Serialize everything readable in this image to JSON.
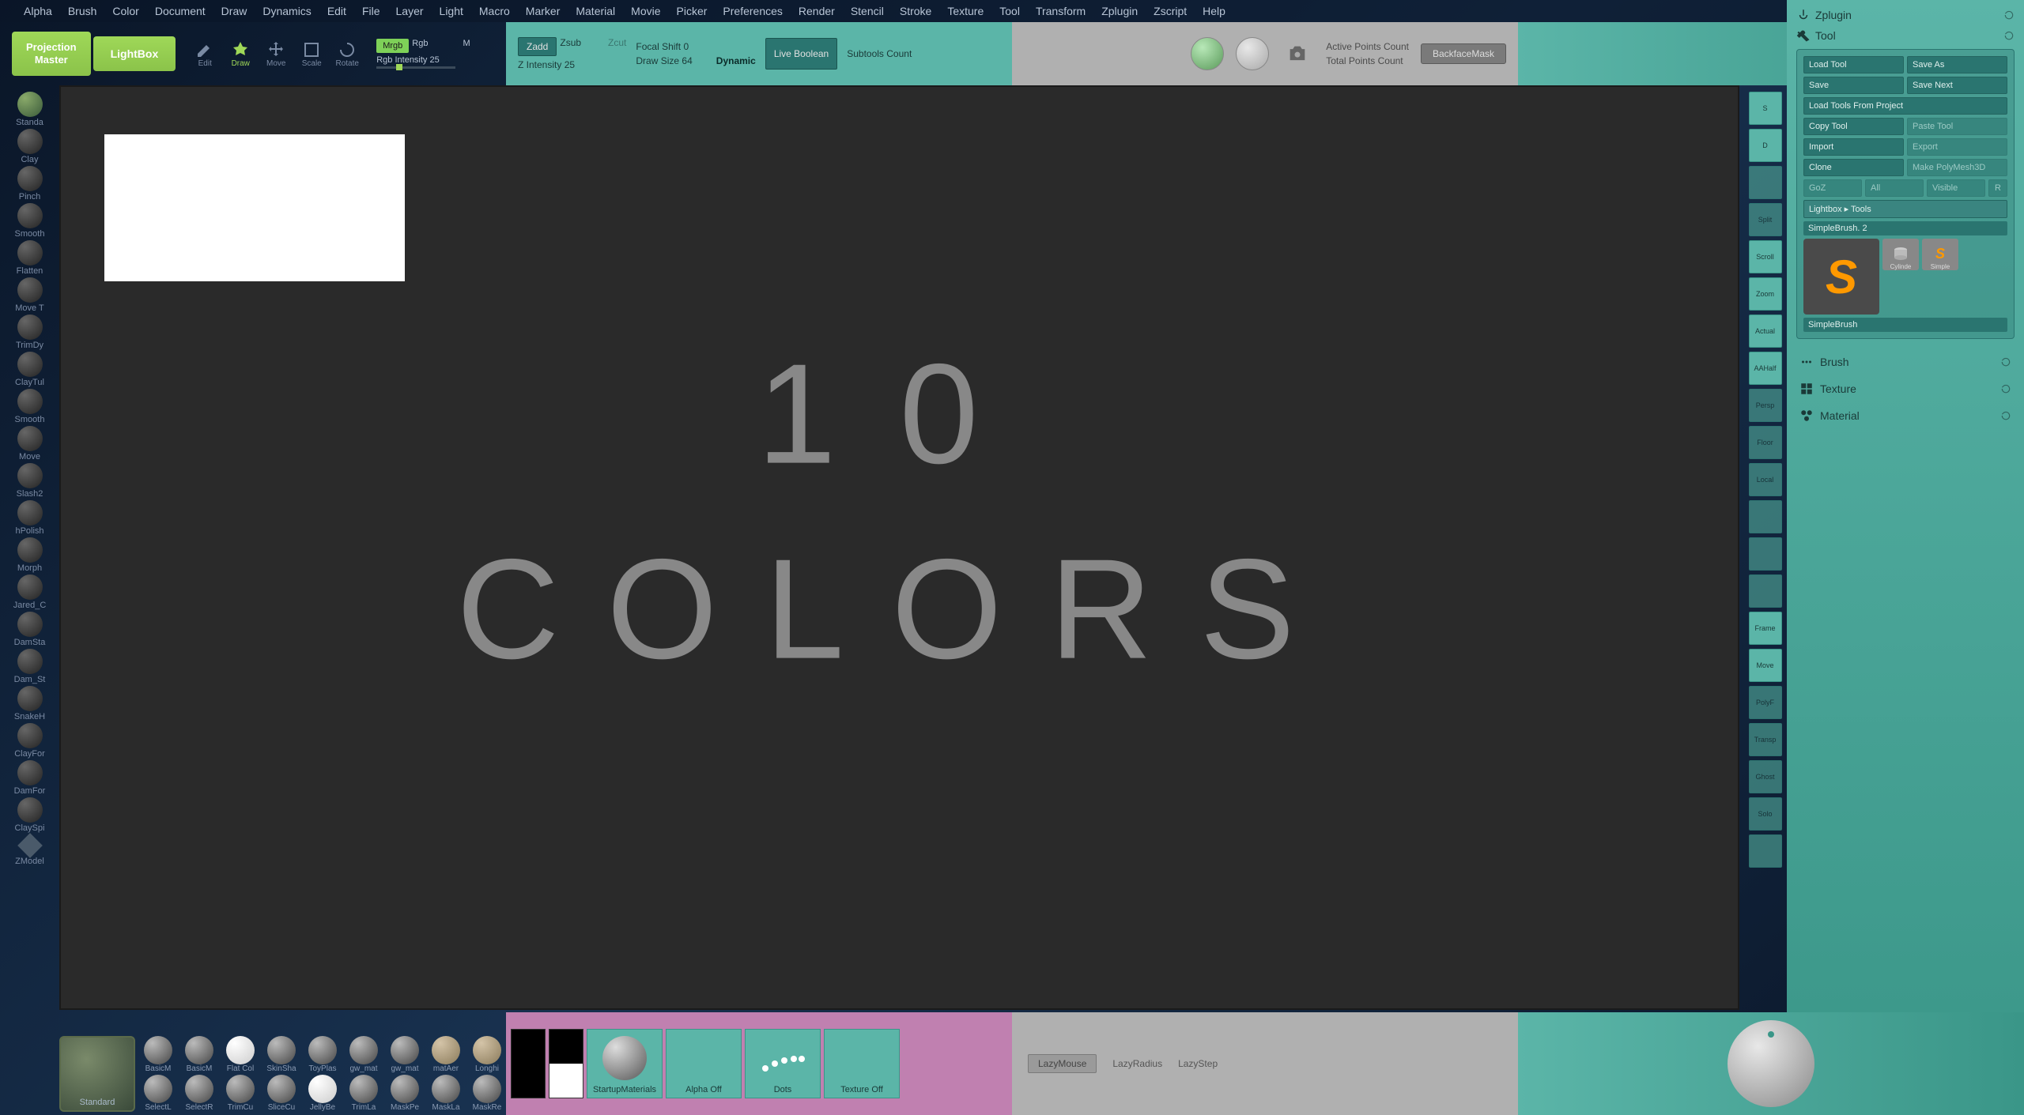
{
  "menu": [
    "Alpha",
    "Brush",
    "Color",
    "Document",
    "Draw",
    "Dynamics",
    "Edit",
    "File",
    "Layer",
    "Light",
    "Macro",
    "Marker",
    "Material",
    "Movie",
    "Picker",
    "Preferences",
    "Render",
    "Stencil",
    "Stroke",
    "Texture",
    "Tool",
    "Transform",
    "Zplugin",
    "Zscript",
    "Help"
  ],
  "toolbar": {
    "projection_master": "Projection\nMaster",
    "lightbox": "LightBox",
    "edit": "Edit",
    "draw": "Draw",
    "move": "Move",
    "scale": "Scale",
    "rotate": "Rotate",
    "mrgb": "Mrgb",
    "rgb": "Rgb",
    "m": "M",
    "rgb_intensity_label": "Rgb Intensity",
    "rgb_intensity_val": "25",
    "zadd": "Zadd",
    "zsub": "Zsub",
    "zcut": "Zcut",
    "z_intensity_label": "Z Intensity",
    "z_intensity_val": "25",
    "focal_shift_label": "Focal Shift",
    "focal_shift_val": "0",
    "draw_size_label": "Draw Size",
    "draw_size_val": "64",
    "dynamic": "Dynamic",
    "live_boolean": "Live Boolean",
    "subtools_count": "Subtools Count",
    "active_points": "Active Points Count",
    "total_points": "Total Points Count",
    "backface_mask": "BackfaceMask"
  },
  "left_brushes": [
    "Standa",
    "Clay",
    "Pinch",
    "Smooth",
    "Flatten",
    "Move T",
    "TrimDy",
    "ClayTul",
    "Smooth",
    "Move",
    "Slash2",
    "hPolish",
    "Morph",
    "Jared_C",
    "DamSta",
    "Dam_St",
    "SnakeH",
    "ClayFor",
    "DamFor",
    "ClaySpi",
    "ZModel"
  ],
  "canvas": {
    "line1": "10",
    "line2": "COLORS"
  },
  "right_rail": [
    {
      "label": "S",
      "name": "sculptris-pro"
    },
    {
      "label": "D",
      "name": "dynamesh"
    },
    {
      "label": "",
      "name": "rail-item-1",
      "dim": true
    },
    {
      "label": "Split",
      "name": "split",
      "dim": true
    },
    {
      "label": "Scroll",
      "name": "scroll"
    },
    {
      "label": "Zoom",
      "name": "zoom"
    },
    {
      "label": "Actual",
      "name": "actual"
    },
    {
      "label": "AAHalf",
      "name": "aahalf"
    },
    {
      "label": "Persp",
      "name": "persp",
      "dim": true
    },
    {
      "label": "Floor",
      "name": "floor",
      "dim": true
    },
    {
      "label": "Local",
      "name": "local",
      "dim": true
    },
    {
      "label": "",
      "name": "rail-item-2",
      "dim": true
    },
    {
      "label": "",
      "name": "rail-item-3",
      "dim": true
    },
    {
      "label": "",
      "name": "rail-item-4",
      "dim": true
    },
    {
      "label": "Frame",
      "name": "frame"
    },
    {
      "label": "Move",
      "name": "move-view"
    },
    {
      "label": "PolyF",
      "name": "polyf",
      "dim": true
    },
    {
      "label": "Transp",
      "name": "transp",
      "dim": true
    },
    {
      "label": "Ghost",
      "name": "ghost",
      "dim": true
    },
    {
      "label": "Solo",
      "name": "solo",
      "dim": true
    },
    {
      "label": "",
      "name": "rail-item-5",
      "dim": true
    }
  ],
  "right_panel": {
    "zplugin": "Zplugin",
    "tool": "Tool",
    "load_tool": "Load Tool",
    "save_as": "Save As",
    "save": "Save",
    "save_next": "Save Next",
    "load_from_project": "Load Tools From Project",
    "copy_tool": "Copy Tool",
    "paste_tool": "Paste Tool",
    "import": "Import",
    "export": "Export",
    "clone": "Clone",
    "make_polymesh": "Make PolyMesh3D",
    "goz": "GoZ",
    "all": "All",
    "visible": "Visible",
    "r": "R",
    "lightbox_tools": "Lightbox ▸ Tools",
    "simplebrush_row": "SimpleBrush. 2",
    "cylinder": "Cylinde",
    "simple": "Simple",
    "simplebrush_label": "SimpleBrush",
    "brush": "Brush",
    "texture": "Texture",
    "material": "Material"
  },
  "bottom": {
    "active_brush": "Standard",
    "materials1": [
      "BasicM",
      "BasicM",
      "Flat Col",
      "SkinSha",
      "ToyPlas",
      "gw_mat",
      "gw_mat",
      "matAer",
      "Longhi"
    ],
    "materials2": [
      "SelectL",
      "SelectR",
      "TrimCu",
      "SliceCu",
      "JellyBe",
      "TrimLa",
      "MaskPe",
      "MaskLa",
      "MaskRe"
    ],
    "startup_materials": "StartupMaterials",
    "alpha_off": "Alpha Off",
    "dots": "Dots",
    "texture_off": "Texture Off",
    "lazymouse": "LazyMouse",
    "lazyradius": "LazyRadius",
    "lazystep": "LazyStep"
  }
}
